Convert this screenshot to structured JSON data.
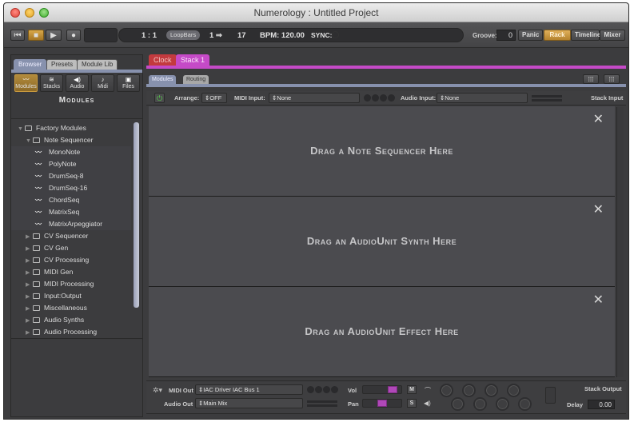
{
  "window": {
    "title": "Numerology : Untitled Project"
  },
  "transport": {
    "buttons": [
      {
        "name": "rewind",
        "icon": "skip-to-start-icon",
        "glyph": "⏮"
      },
      {
        "name": "stop",
        "icon": "stop-icon",
        "glyph": "■",
        "active": true
      },
      {
        "name": "play",
        "icon": "play-icon",
        "glyph": "▶"
      },
      {
        "name": "record",
        "icon": "record-icon",
        "glyph": "●"
      }
    ],
    "position": "1 : 1",
    "loop_label": "LoopBars",
    "loop_range": "1 ⇒",
    "loop_end": "17",
    "bpm": "BPM: 120.00",
    "sync_label": "SYNC:",
    "groove_label": "Groove:",
    "groove_value": "0",
    "panic_label": "Panic",
    "views": [
      {
        "label": "Rack",
        "active": true
      },
      {
        "label": "Timeline",
        "active": false
      },
      {
        "label": "Mixer",
        "active": false
      }
    ]
  },
  "browser": {
    "tabs": [
      {
        "label": "Browser",
        "active": true
      },
      {
        "label": "Presets",
        "active": false
      },
      {
        "label": "Module Lib",
        "active": false
      }
    ],
    "categories": [
      {
        "label": "Modules",
        "glyph": "〰",
        "icon": "wave-icon",
        "active": true
      },
      {
        "label": "Stacks",
        "glyph": "≋",
        "icon": "stacks-icon",
        "active": false
      },
      {
        "label": "Audio",
        "glyph": "◀)",
        "icon": "speaker-icon",
        "active": false
      },
      {
        "label": "Midi",
        "glyph": "♪",
        "icon": "note-icon",
        "active": false
      },
      {
        "label": "Files",
        "glyph": "▣",
        "icon": "file-icon",
        "active": false
      }
    ],
    "heading": "Modules",
    "tree": [
      {
        "label": "Factory Modules",
        "type": "folder",
        "level": 0,
        "expanded": true
      },
      {
        "label": "Note Sequencer",
        "type": "folder",
        "level": 1,
        "expanded": true
      },
      {
        "label": "MonoNote",
        "type": "module",
        "level": 2
      },
      {
        "label": "PolyNote",
        "type": "module",
        "level": 2
      },
      {
        "label": "DrumSeq-8",
        "type": "module",
        "level": 2
      },
      {
        "label": "DrumSeq-16",
        "type": "module",
        "level": 2
      },
      {
        "label": "ChordSeq",
        "type": "module",
        "level": 2
      },
      {
        "label": "MatrixSeq",
        "type": "module",
        "level": 2
      },
      {
        "label": "MatrixArpeggiator",
        "type": "module",
        "level": 2
      },
      {
        "label": "CV Sequencer",
        "type": "folder",
        "level": 1,
        "expanded": false
      },
      {
        "label": "CV Gen",
        "type": "folder",
        "level": 1,
        "expanded": false
      },
      {
        "label": "CV Processing",
        "type": "folder",
        "level": 1,
        "expanded": false
      },
      {
        "label": "MIDI Gen",
        "type": "folder",
        "level": 1,
        "expanded": false
      },
      {
        "label": "MIDI Processing",
        "type": "folder",
        "level": 1,
        "expanded": false
      },
      {
        "label": "Input:Output",
        "type": "folder",
        "level": 1,
        "expanded": false
      },
      {
        "label": "Miscellaneous",
        "type": "folder",
        "level": 1,
        "expanded": false
      },
      {
        "label": "Audio Synths",
        "type": "folder",
        "level": 1,
        "expanded": false
      },
      {
        "label": "Audio Processing",
        "type": "folder",
        "level": 1,
        "expanded": false
      }
    ]
  },
  "stack": {
    "tabs": [
      {
        "label": "Clock",
        "color": "#c33a3e"
      },
      {
        "label": "Stack 1",
        "color": "#c54ac7",
        "active": true
      }
    ],
    "subtabs": [
      {
        "label": "Modules",
        "active": true
      },
      {
        "label": "Routing",
        "active": false
      }
    ],
    "grid_buttons": [
      "⁞⁞⁞",
      "⁞⁞⁞"
    ],
    "input": {
      "arrange_label": "Arrange:",
      "arrange_value": "⇕OFF",
      "midi_input_label": "MIDI Input:",
      "midi_input_value": "⇕None",
      "audio_input_label": "Audio Input:",
      "audio_input_value": "⇕None",
      "title": "Stack Input"
    },
    "slots": [
      {
        "text": "Drag a Note Sequencer Here",
        "close": "✕"
      },
      {
        "text": "Drag an AudioUnit Synth Here",
        "close": "✕"
      },
      {
        "text": "Drag an AudioUnit Effect Here",
        "close": "✕"
      }
    ],
    "output": {
      "gear": "✲▾",
      "midi_out_label": "MIDI Out",
      "midi_out_value": "⇕IAC Driver IAC Bus 1",
      "audio_out_label": "Audio Out",
      "audio_out_value": "⇕Main Mix",
      "vol_label": "Vol",
      "vol_level": 0.85,
      "pan_label": "Pan",
      "pan_level": 0.5,
      "mute_label": "M",
      "solo_label": "S",
      "headphones_glyph": "⌒",
      "speaker_glyph": "◀)",
      "title": "Stack Output",
      "delay_label": "Delay",
      "delay_value": "0.00"
    }
  },
  "colors": {
    "accent_stack": "#c54ac7",
    "accent_clock": "#c33a3e",
    "accent_active": "#c99a3e",
    "accent_browser": "#8791ad"
  }
}
